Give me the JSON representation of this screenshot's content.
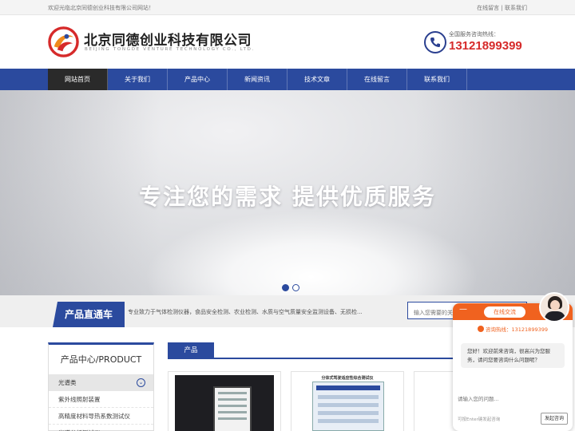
{
  "topbar": {
    "welcome": "欢迎光临北京同德创业科技有限公司网站！",
    "link_message": "在线留言",
    "separator": "|",
    "link_contact": "联系我们"
  },
  "header": {
    "company_cn": "北京同德创业科技有限公司",
    "company_en": "BEIJING TONGDE VENTURE TECHNOLOGY CO., LTD.",
    "hotline_label": "全国服务咨询热线：",
    "hotline_number": "13121899399"
  },
  "nav": {
    "items": [
      {
        "label": "网站首页",
        "active": true
      },
      {
        "label": "关于我们",
        "active": false
      },
      {
        "label": "产品中心",
        "active": false
      },
      {
        "label": "新闻资讯",
        "active": false
      },
      {
        "label": "技术文章",
        "active": false
      },
      {
        "label": "在线留言",
        "active": false
      },
      {
        "label": "联系我们",
        "active": false
      }
    ]
  },
  "banner": {
    "slogan": "专注您的需求  提供优质服务",
    "slides_total": 2,
    "slide_active": 1
  },
  "strip": {
    "tag": "产品直通车",
    "description": "专业致力于气体检测仪器，食品安全检测、农业检测、水质与空气质量安全监测设备、无损检...",
    "search_placeholder": "输入您需要的关"
  },
  "sidebar": {
    "title": "产品中心/PRODUCT",
    "category": "光谱类",
    "items": [
      "紫外线照射装置",
      "高精度材料导热系数测试仪",
      "光谱分析测试仪"
    ]
  },
  "products": {
    "tab": "产品",
    "card2_title": "分体式驾驶适应性综合测试仪"
  },
  "chat": {
    "minimize": "—",
    "header": "在线交流",
    "hotline": "咨询热线：13121899399",
    "greeting": "您好！欢迎前来咨询，很高兴为您服务，请问您要咨询什么问题呢？",
    "input_placeholder": "请输入您的问题...",
    "hint": "可按Enter键发起咨询",
    "send": "发起咨询"
  },
  "colors": {
    "brand_blue": "#2b4a9e",
    "hotline_red": "#d62a2a",
    "chat_orange": "#f0621f",
    "nav_active": "#2a2a2a"
  }
}
